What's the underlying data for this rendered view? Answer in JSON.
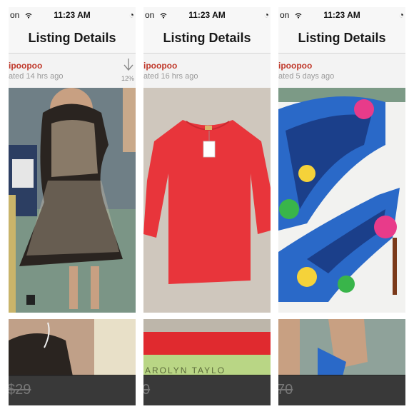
{
  "panels": [
    {
      "status": {
        "carrier": "on",
        "time": "11:23 AM"
      },
      "nav_title": "Listing Details",
      "seller": "ipoopoo",
      "updated": "ated 14 hrs ago",
      "download_pct": "12%",
      "price": "$29"
    },
    {
      "status": {
        "carrier": "on",
        "time": "11:23 AM"
      },
      "nav_title": "Listing Details",
      "seller": "ipoopoo",
      "updated": "ated 16 hrs ago",
      "price": "0",
      "tag_text": "AROLYN TAYLO"
    },
    {
      "status": {
        "carrier": "on",
        "time": "11:23 AM"
      },
      "nav_title": "Listing Details",
      "seller": "ipoopoo",
      "updated": "ated 5 days ago",
      "price": "70"
    }
  ],
  "colors": {
    "seller": "#c0392b",
    "red_sweater": "#e8353b",
    "shoe_blue": "#2a69c8"
  },
  "icons": {
    "wifi": "wifi-icon",
    "lock": "orientation-lock-icon",
    "download": "download-arrow-icon"
  }
}
